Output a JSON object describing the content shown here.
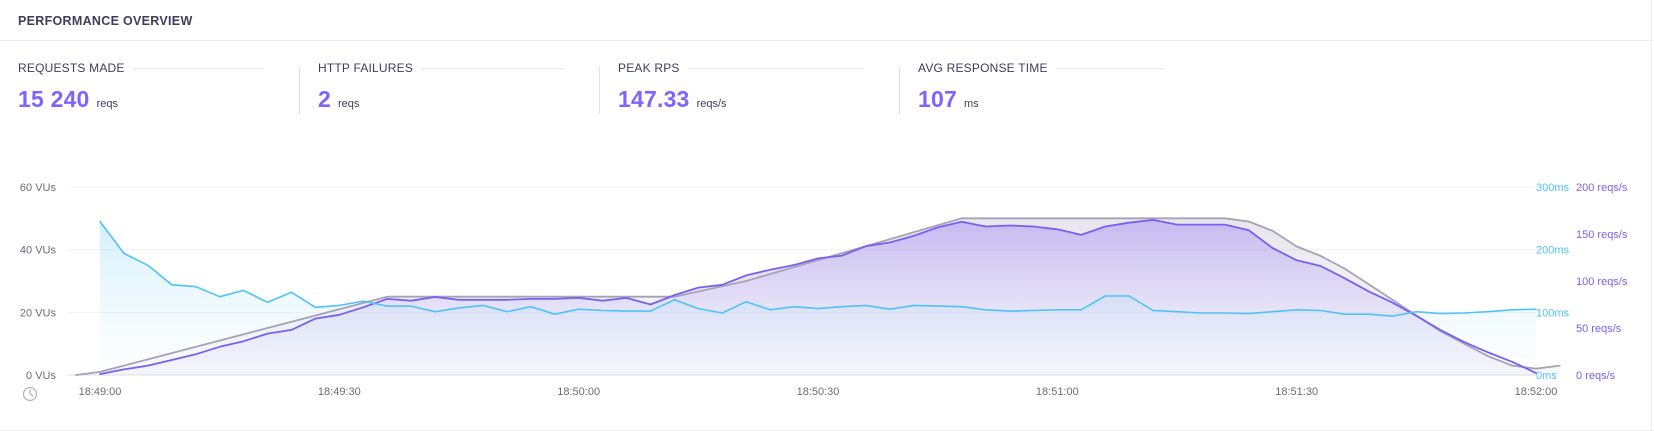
{
  "header": {
    "title": "PERFORMANCE OVERVIEW"
  },
  "stats": [
    {
      "label": "REQUESTS MADE",
      "value": "15 240",
      "unit": "reqs"
    },
    {
      "label": "HTTP FAILURES",
      "value": "2",
      "unit": "reqs"
    },
    {
      "label": "PEAK RPS",
      "value": "147.33",
      "unit": "reqs/s"
    },
    {
      "label": "AVG RESPONSE TIME",
      "value": "107",
      "unit": "ms"
    }
  ],
  "colors": {
    "accent": "#7d64ff",
    "vus": "#a6a2b8",
    "rps": "#7b5ff0",
    "response": "#4fc3f7"
  },
  "chart_data": {
    "type": "line",
    "x_tick_labels": [
      "18:49:00",
      "18:49:30",
      "18:50:00",
      "18:50:30",
      "18:51:00",
      "18:51:30",
      "18:52:00"
    ],
    "clock_icon": "clock-icon",
    "axes": {
      "vus": {
        "ticks": [
          "0 VUs",
          "20 VUs",
          "40 VUs",
          "60 VUs"
        ],
        "range": [
          0,
          60
        ]
      },
      "response_time": {
        "ticks": [
          "0ms",
          "100ms",
          "200ms",
          "300ms"
        ],
        "range": [
          0,
          300
        ]
      },
      "rps": {
        "ticks": [
          "0 reqs/s",
          "50 reqs/s",
          "100 reqs/s",
          "150 reqs/s",
          "200 reqs/s"
        ],
        "range": [
          0,
          200
        ]
      }
    },
    "x_range_seconds": [
      0,
      183
    ],
    "series": [
      {
        "key": "vus",
        "axis": "vus",
        "points": [
          [
            -3,
            0
          ],
          [
            0,
            1
          ],
          [
            36,
            25
          ],
          [
            72,
            25
          ],
          [
            81,
            30
          ],
          [
            108,
            50
          ],
          [
            141,
            50
          ],
          [
            144,
            49
          ],
          [
            147,
            46
          ],
          [
            150,
            41
          ],
          [
            153,
            38
          ],
          [
            156,
            34
          ],
          [
            159,
            29
          ],
          [
            162,
            24
          ],
          [
            165,
            19
          ],
          [
            168,
            14
          ],
          [
            171,
            10
          ],
          [
            174,
            6
          ],
          [
            177,
            3
          ],
          [
            180,
            2
          ],
          [
            183,
            3
          ]
        ]
      },
      {
        "key": "rps",
        "axis": "rps",
        "points": [
          [
            0,
            1
          ],
          [
            3,
            6
          ],
          [
            6,
            10
          ],
          [
            9,
            16
          ],
          [
            12,
            22
          ],
          [
            15,
            30
          ],
          [
            18,
            36
          ],
          [
            21,
            44
          ],
          [
            24,
            48
          ],
          [
            27,
            60
          ],
          [
            30,
            64
          ],
          [
            33,
            72
          ],
          [
            36,
            81
          ],
          [
            39,
            79
          ],
          [
            42,
            83
          ],
          [
            45,
            80
          ],
          [
            48,
            80
          ],
          [
            51,
            80
          ],
          [
            54,
            81
          ],
          [
            57,
            81
          ],
          [
            60,
            82
          ],
          [
            63,
            79
          ],
          [
            66,
            82
          ],
          [
            69,
            75
          ],
          [
            72,
            85
          ],
          [
            75,
            93
          ],
          [
            78,
            96
          ],
          [
            81,
            106
          ],
          [
            84,
            112
          ],
          [
            87,
            117
          ],
          [
            90,
            124
          ],
          [
            93,
            127
          ],
          [
            96,
            137
          ],
          [
            99,
            141
          ],
          [
            102,
            148
          ],
          [
            105,
            157
          ],
          [
            108,
            163
          ],
          [
            111,
            158
          ],
          [
            114,
            159
          ],
          [
            117,
            158
          ],
          [
            120,
            155
          ],
          [
            123,
            149
          ],
          [
            126,
            158
          ],
          [
            129,
            162
          ],
          [
            132,
            165
          ],
          [
            135,
            160
          ],
          [
            138,
            160
          ],
          [
            141,
            160
          ],
          [
            144,
            154
          ],
          [
            147,
            135
          ],
          [
            150,
            122
          ],
          [
            153,
            116
          ],
          [
            156,
            103
          ],
          [
            159,
            89
          ],
          [
            162,
            77
          ],
          [
            165,
            63
          ],
          [
            168,
            48
          ],
          [
            171,
            35
          ],
          [
            174,
            24
          ],
          [
            177,
            14
          ],
          [
            180,
            2
          ]
        ]
      },
      {
        "key": "response",
        "axis": "response_time",
        "points": [
          [
            0,
            245
          ],
          [
            3,
            194
          ],
          [
            6,
            175
          ],
          [
            9,
            144
          ],
          [
            12,
            141
          ],
          [
            15,
            125
          ],
          [
            18,
            135
          ],
          [
            21,
            116
          ],
          [
            24,
            132
          ],
          [
            27,
            108
          ],
          [
            30,
            111
          ],
          [
            33,
            118
          ],
          [
            36,
            110
          ],
          [
            39,
            110
          ],
          [
            42,
            101
          ],
          [
            45,
            107
          ],
          [
            48,
            111
          ],
          [
            51,
            101
          ],
          [
            54,
            109
          ],
          [
            57,
            97
          ],
          [
            60,
            105
          ],
          [
            63,
            103
          ],
          [
            66,
            102
          ],
          [
            69,
            102
          ],
          [
            72,
            120
          ],
          [
            75,
            106
          ],
          [
            78,
            99
          ],
          [
            81,
            117
          ],
          [
            84,
            104
          ],
          [
            87,
            109
          ],
          [
            90,
            106
          ],
          [
            93,
            109
          ],
          [
            96,
            111
          ],
          [
            99,
            105
          ],
          [
            102,
            111
          ],
          [
            105,
            110
          ],
          [
            108,
            109
          ],
          [
            111,
            104
          ],
          [
            114,
            102
          ],
          [
            117,
            103
          ],
          [
            120,
            104
          ],
          [
            123,
            104
          ],
          [
            126,
            126
          ],
          [
            129,
            126
          ],
          [
            132,
            103
          ],
          [
            135,
            101
          ],
          [
            138,
            99
          ],
          [
            141,
            99
          ],
          [
            144,
            98
          ],
          [
            147,
            101
          ],
          [
            150,
            104
          ],
          [
            153,
            103
          ],
          [
            156,
            97
          ],
          [
            159,
            97
          ],
          [
            162,
            94
          ],
          [
            165,
            101
          ],
          [
            168,
            98
          ],
          [
            171,
            99
          ],
          [
            174,
            101
          ],
          [
            177,
            104
          ],
          [
            180,
            105
          ]
        ]
      }
    ]
  }
}
